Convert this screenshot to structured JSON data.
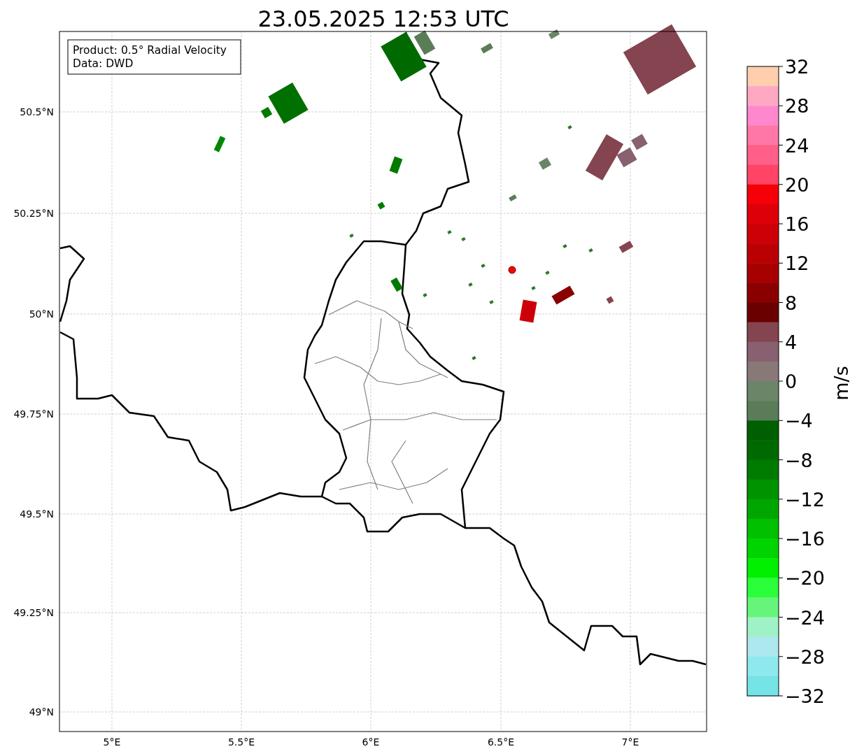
{
  "title": "23.05.2025 12:53 UTC",
  "info_box": [
    "Product: 0.5° Radial Velocity",
    "Data: DWD"
  ],
  "y_ticks": [
    "50.5°N",
    "50.25°N",
    "50°N",
    "49.75°N",
    "49.5°N",
    "49.25°N",
    "49°N"
  ],
  "x_ticks": [
    "5°E",
    "5.5°E",
    "6°E",
    "6.5°E",
    "7°E"
  ],
  "colorbar": {
    "label": "m/s",
    "ticks": [
      "32",
      "28",
      "24",
      "20",
      "16",
      "12",
      "8",
      "4",
      "0",
      "−4",
      "−8",
      "−12",
      "−16",
      "−20",
      "−24",
      "−28",
      "−32"
    ],
    "bins": [
      {
        "color": "#ffcfad"
      },
      {
        "color": "#ffa8c4"
      },
      {
        "color": "#ff88cc"
      },
      {
        "color": "#ff77a6"
      },
      {
        "color": "#ff5f88"
      },
      {
        "color": "#ff4466"
      },
      {
        "color": "#f50008"
      },
      {
        "color": "#dd0008"
      },
      {
        "color": "#cc0006"
      },
      {
        "color": "#bb0004"
      },
      {
        "color": "#a60000"
      },
      {
        "color": "#8a0000"
      },
      {
        "color": "#6b0000"
      },
      {
        "color": "#844450"
      },
      {
        "color": "#886070"
      },
      {
        "color": "#887878"
      },
      {
        "color": "#6a8568"
      },
      {
        "color": "#5a7d58"
      },
      {
        "color": "#005f00"
      },
      {
        "color": "#006a00"
      },
      {
        "color": "#007b00"
      },
      {
        "color": "#009300"
      },
      {
        "color": "#00a600"
      },
      {
        "color": "#00c000"
      },
      {
        "color": "#00d400"
      },
      {
        "color": "#00f000"
      },
      {
        "color": "#2bff3a"
      },
      {
        "color": "#66f57a"
      },
      {
        "color": "#9ff2c6"
      },
      {
        "color": "#ade8ee"
      },
      {
        "color": "#8ee9ee"
      },
      {
        "color": "#76e3e6"
      }
    ]
  }
}
